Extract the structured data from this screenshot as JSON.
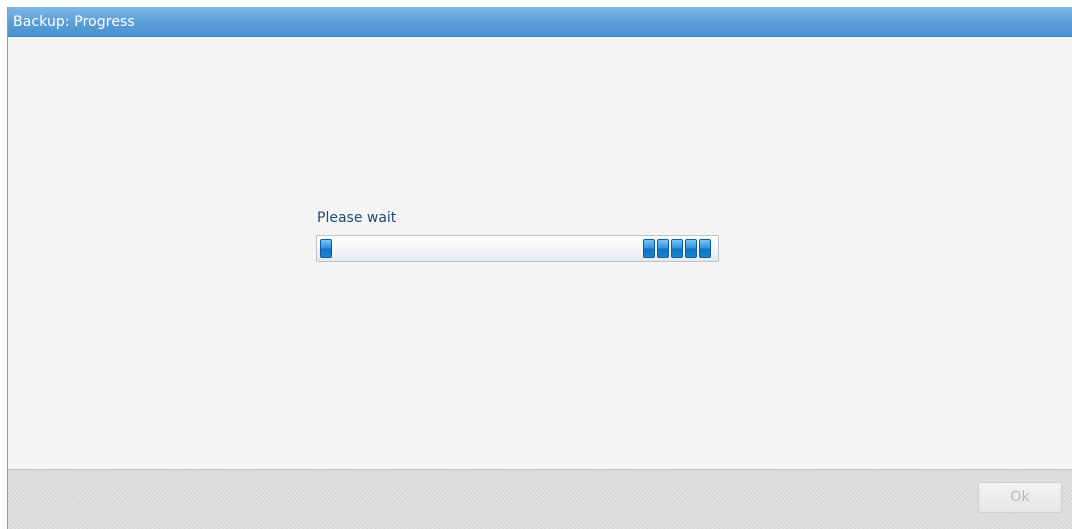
{
  "dialog": {
    "title": "Backup: Progress",
    "message": "Please wait",
    "progress": {
      "state": "indeterminate"
    },
    "footer": {
      "ok_label": "Ok",
      "ok_enabled": false
    }
  },
  "colors": {
    "title_bar": "#5a9ed8",
    "progress_segment": "#1a86d2",
    "message_text": "#244a78",
    "disabled_text": "#b9b9b9"
  }
}
